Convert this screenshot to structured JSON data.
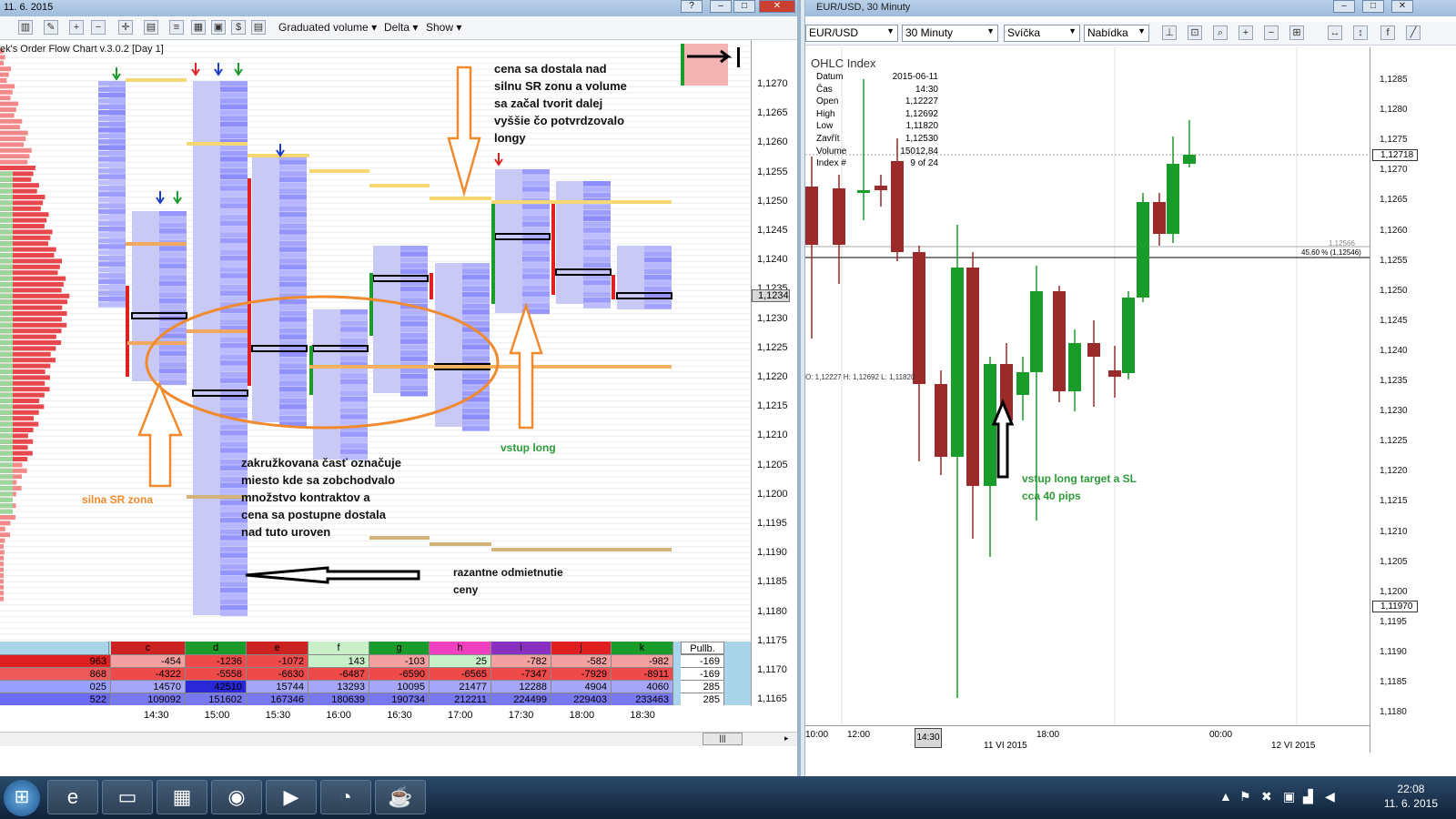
{
  "left": {
    "title_date": "11. 6. 2015",
    "toolbar_menus": [
      "Graduated volume",
      "Delta",
      "Show"
    ],
    "chart_title": "ek's Order Flow Chart v.3.0.2 [Day 1]",
    "price_labels": [
      "1,1270",
      "1,1265",
      "1,1260",
      "1,1255",
      "1,1250",
      "1,1245",
      "1,1240",
      "1,1235",
      "1,1230",
      "1,1225",
      "1,1220",
      "1,1215",
      "1,1210",
      "1,1205",
      "1,1200",
      "1,1195",
      "1,1190",
      "1,1185",
      "1,1180",
      "1,1175",
      "1,1170",
      "1,1165"
    ],
    "price_marker": "1,1234",
    "annotations": {
      "cena": "cena sa dostala nad\nsilnu SR zonu a volume\nsa začal tvorit dalej\nvyššie čo potvrdzovalo\nlongy",
      "zakruzkovana": "zakružkovana časť označuje\nmiesto kde sa zobchodvalo\nmnožstvo kontraktov a\ncena sa postupne dostala\nnad tuto uroven",
      "silna": "silna SR zona",
      "vstup": "vstup long",
      "razantne": "razantne odmietnutie\nceny"
    },
    "stats": {
      "headers": [
        "c",
        "d",
        "e",
        "f",
        "g",
        "h",
        "i",
        "j",
        "k"
      ],
      "pullb_label": "Pullb.",
      "left_col": [
        "963",
        "868",
        "025",
        "522"
      ],
      "rows": [
        [
          "-454",
          "-1236",
          "-1072",
          "143",
          "-103",
          "25",
          "-782",
          "-582",
          "-982"
        ],
        [
          "-4322",
          "-5558",
          "-6630",
          "-6487",
          "-6590",
          "-6565",
          "-7347",
          "-7929",
          "-8911"
        ],
        [
          "14570",
          "42510",
          "15744",
          "13293",
          "10095",
          "21477",
          "12288",
          "4904",
          "4060"
        ],
        [
          "109092",
          "151602",
          "167346",
          "180639",
          "190734",
          "212211",
          "224499",
          "229403",
          "233463"
        ]
      ],
      "pullb": [
        "-169",
        "-169",
        "285",
        "285"
      ]
    },
    "time_labels": [
      "14:30",
      "15:00",
      "15:30",
      "16:00",
      "16:30",
      "17:00",
      "17:30",
      "18:00",
      "18:30"
    ]
  },
  "right": {
    "title": "EUR/USD, 30 Minuty",
    "symbol": "EUR/USD",
    "timeframe": "30 Minuty",
    "chart_type": "Svíčka",
    "price_type": "Nabídka",
    "ohlc": {
      "title": "OHLC Index",
      "rows": [
        {
          "k": "Datum",
          "v": "2015-06-11"
        },
        {
          "k": "Čas",
          "v": "14:30"
        },
        {
          "k": "Open",
          "v": "1,12227"
        },
        {
          "k": "High",
          "v": "1,12692"
        },
        {
          "k": "Low",
          "v": "1,11820"
        },
        {
          "k": "Zavřít",
          "v": "1,12530"
        },
        {
          "k": "Volume",
          "v": "15012,84"
        },
        {
          "k": "Index #",
          "v": "9 of 24"
        }
      ]
    },
    "price_labels": [
      "1,1285",
      "1,1280",
      "1,1275",
      "1,1270",
      "1,1265",
      "1,1260",
      "1,1255",
      "1,1250",
      "1,1245",
      "1,1240",
      "1,1235",
      "1,1230",
      "1,1225",
      "1,1220",
      "1,1215",
      "1,1210",
      "1,1205",
      "1,1200",
      "1,1195",
      "1,1190",
      "1,1185",
      "1,1180"
    ],
    "box_top": "1,12718",
    "box_bottom": "1,11970",
    "fib_label": "45,60 % (1,12546)",
    "fib_small": "1,12566",
    "ohlc_inline": "O: 1,12227   H: 1,12692   L: 1,11820",
    "annotation": "vstup long target a SL\ncca 40 pips",
    "time_labels": [
      "10:00",
      "12:00",
      "18:00",
      "00:00"
    ],
    "date_labels": [
      "11 VI 2015",
      "12 VI 2015"
    ],
    "time_marker": "14:30"
  },
  "taskbar": {
    "time": "22:08",
    "date": "11. 6. 2015"
  }
}
